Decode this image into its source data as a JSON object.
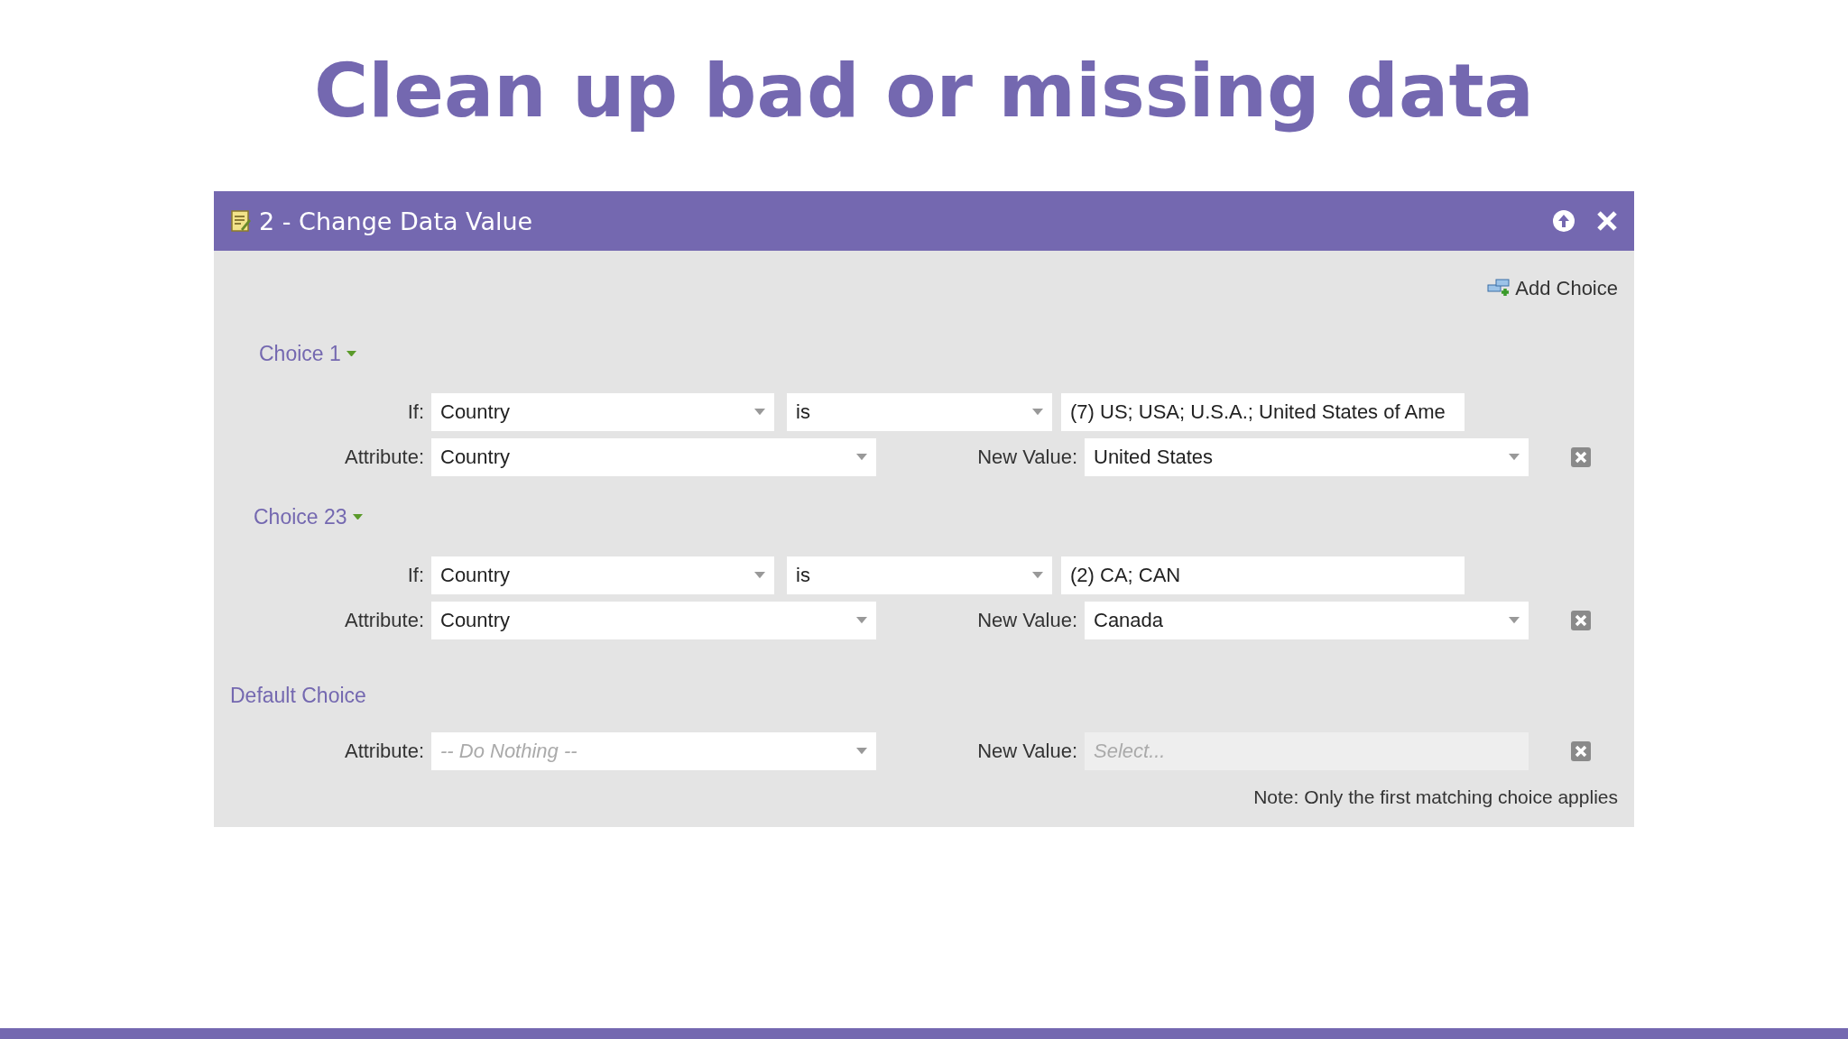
{
  "slide": {
    "title": "Clean up bad or missing data"
  },
  "dialog": {
    "title": "2 - Change Data Value",
    "add_choice": "Add Choice",
    "choices": [
      {
        "kind": "conditional",
        "label": "Choice 1",
        "if_label": "If:",
        "field": "Country",
        "operator": "is",
        "values": "(7) US; USA; U.S.A.; United States of Ame",
        "attribute_label": "Attribute:",
        "attribute": {
          "value": "Country"
        },
        "new_value_label": "New Value:",
        "new_value": {
          "value": "United States"
        }
      },
      {
        "kind": "conditional",
        "label": "Choice 23",
        "if_label": "If:",
        "field": "Country",
        "operator": "is",
        "values": "(2) CA; CAN",
        "attribute_label": "Attribute:",
        "attribute": {
          "value": "Country"
        },
        "new_value_label": "New Value:",
        "new_value": {
          "value": "Canada"
        }
      },
      {
        "kind": "default",
        "label": "Default Choice",
        "attribute_label": "Attribute:",
        "attribute": {
          "placeholder": "-- Do Nothing --"
        },
        "new_value_label": "New Value:",
        "new_value": {
          "placeholder": "Select..."
        }
      }
    ],
    "note": "Note: Only the first matching choice applies"
  }
}
